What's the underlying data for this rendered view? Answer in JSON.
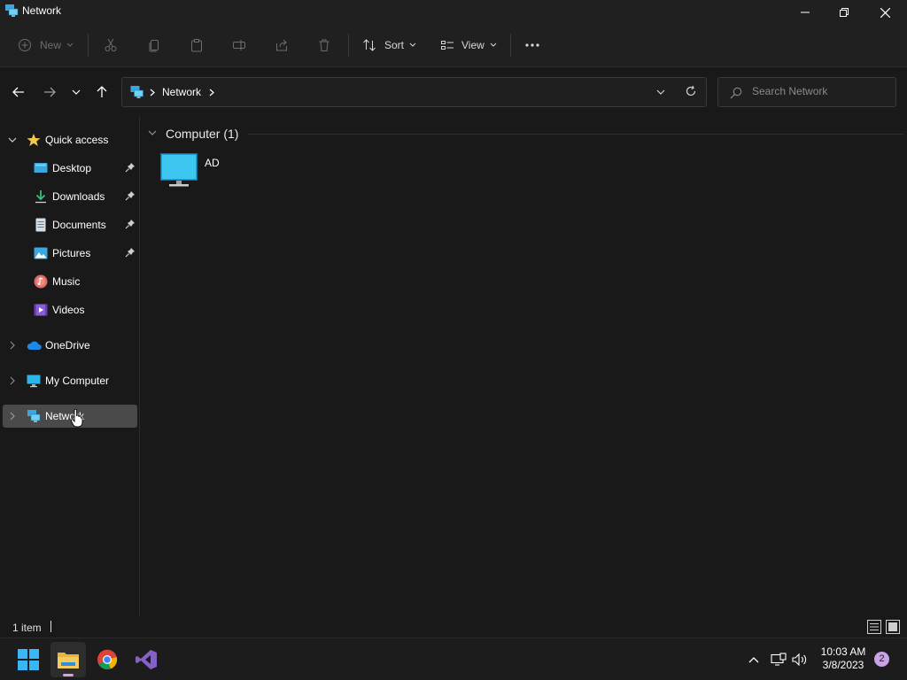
{
  "window": {
    "title": "Network"
  },
  "toolbar": {
    "new_label": "New",
    "sort_label": "Sort",
    "view_label": "View",
    "more_label": "..."
  },
  "address": {
    "crumbs": [
      "Network"
    ],
    "search_placeholder": "Search Network"
  },
  "sidebar": {
    "quick_access": "Quick access",
    "items": [
      {
        "label": "Desktop",
        "icon": "desktop-icon",
        "pinned": true
      },
      {
        "label": "Downloads",
        "icon": "downloads-icon",
        "pinned": true
      },
      {
        "label": "Documents",
        "icon": "documents-icon",
        "pinned": true
      },
      {
        "label": "Pictures",
        "icon": "pictures-icon",
        "pinned": true
      },
      {
        "label": "Music",
        "icon": "music-icon",
        "pinned": false
      },
      {
        "label": "Videos",
        "icon": "videos-icon",
        "pinned": false
      }
    ],
    "onedrive": "OneDrive",
    "my_computer": "My Computer",
    "network": "Network"
  },
  "content": {
    "group_label": "Computer (1)",
    "items": [
      {
        "name": "AD",
        "icon": "monitor-icon"
      }
    ]
  },
  "status": {
    "count": "1 item"
  },
  "taskbar": {
    "time": "10:03 AM",
    "date": "3/8/2023",
    "notifications": "2"
  },
  "colors": {
    "background": "#191919",
    "selected": "#4a4a4a",
    "accent_star": "#f2c94c",
    "monitor": "#2bb5e8"
  }
}
